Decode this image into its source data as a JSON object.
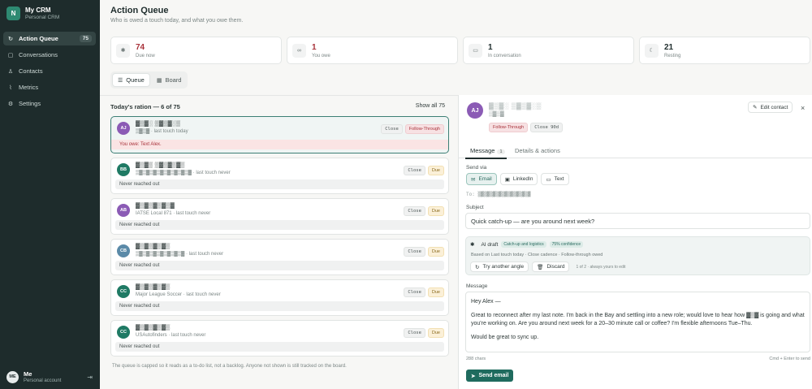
{
  "sidebar": {
    "brand_initial": "N",
    "brand_name": "My CRM",
    "brand_sub": "Personal CRM",
    "items": [
      {
        "label": "Action Queue",
        "icon": "refresh-icon",
        "count": "75"
      },
      {
        "label": "Conversations",
        "icon": "chat-icon"
      },
      {
        "label": "Contacts",
        "icon": "people-icon"
      },
      {
        "label": "Metrics",
        "icon": "chart-icon"
      },
      {
        "label": "Settings",
        "icon": "gear-icon"
      }
    ],
    "user": {
      "initials": "ME",
      "name": "Me",
      "sub": "Personal account"
    }
  },
  "header": {
    "title": "Action Queue",
    "subtitle": "Who is owed a touch today, and what you owe them."
  },
  "stats": [
    {
      "value": "74",
      "label": "Due now",
      "icon": "sparkle-icon"
    },
    {
      "value": "1",
      "label": "You owe",
      "icon": "link-icon"
    },
    {
      "value": "1",
      "label": "In conversation",
      "icon": "chat-icon"
    },
    {
      "value": "21",
      "label": "Resting",
      "icon": "moon-icon"
    }
  ],
  "view_toggle": {
    "queue": "Queue",
    "board": "Board"
  },
  "queue": {
    "title": "Today's ration — 6 of 75",
    "show_all": "Show all 75",
    "cards": [
      {
        "initials": "AJ",
        "name": "▓▒▓░ ▒▓▒▓░▒",
        "sub": "▒▓▒▓ · last touch today",
        "tags": [
          "Close",
          "Follow-Through"
        ],
        "foot": "You owe: Text Alex.",
        "color": "#8b5bb5"
      },
      {
        "initials": "BB",
        "name": "▓▒▓▒ ▒▓▒▓▒▓▒",
        "sub": "▒▓▒▓▒▓▒▓▒▓▒▓▒▓▒▓ · last touch never",
        "tags": [
          "Close",
          "Due"
        ],
        "foot": "Never reached out",
        "color": "#1f7a64"
      },
      {
        "initials": "AB",
        "name": "▓▒▓▒▓▒▓▒▓",
        "sub": "IATSE Local 871 · last touch never",
        "tags": [
          "Close",
          "Due"
        ],
        "foot": "Never reached out",
        "color": "#8b5bb5"
      },
      {
        "initials": "CB",
        "name": "▓▒▓▒▓▒▓▒",
        "sub": "▒▓▒▓▒▓▒▓▒▓▒▓▒▓ · last touch never",
        "tags": [
          "Close",
          "Due"
        ],
        "foot": "Never reached out",
        "color": "#5b8aa8"
      },
      {
        "initials": "CC",
        "name": "▓▒▓▒▓▒▓▒",
        "sub": "Major League Soccer · last touch never",
        "tags": [
          "Close",
          "Due"
        ],
        "foot": "Never reached out",
        "color": "#1f7a64"
      },
      {
        "initials": "CC",
        "name": "▓▒▓▒▓▒▓▒",
        "sub": "USAutofinders · last touch never",
        "tags": [
          "Close",
          "Due"
        ],
        "foot": "Never reached out",
        "color": "#1f7a64"
      }
    ],
    "note": "The queue is capped so it reads as a to-do list, not a backlog. Anyone not shown is still tracked on the board."
  },
  "detail": {
    "initials": "AJ",
    "name": "▓▒▓░ ▒▓▒▓░▒",
    "sub": "▒▓▒▓",
    "tags": [
      "Follow-Through",
      "Close 90d"
    ],
    "edit_label": "Edit contact",
    "close_glyph": "×",
    "tabs": [
      {
        "label": "Message",
        "count": "1"
      },
      {
        "label": "Details & actions"
      }
    ],
    "send_via_label": "Send via",
    "channels": [
      "Email",
      "LinkedIn",
      "Text"
    ],
    "to": "To: ▒▓▒▓▒▓▒▓▒▓▒▓▒▓▒▓▒▓",
    "subject_label": "Subject",
    "subject_value": "Quick catch-up — are you around next week?",
    "ai": {
      "title": "AI draft",
      "chip1": "Catch-up and logistics",
      "chip2": "75% confidence",
      "basis": "Based on Last touch today · Close cadence · Follow-through owed",
      "retry": "Try another angle",
      "discard": "Discard",
      "note": "1 of 2 · always yours to edit"
    },
    "message_label": "Message",
    "message_lines": [
      "Hey Alex —",
      "Great to reconnect after my last note. I'm back in the Bay and settling into a new role; would love to hear how ▓▒▓ is going and what you're working on. Are you around next week for a 20–30 minute call or coffee? I'm flexible afternoons Tue–Thu.",
      "Would be great to sync up."
    ],
    "chars": "288 chars",
    "hint": "Cmd + Enter to send",
    "send_label": "Send email"
  },
  "colors": {
    "accent": "#1f6b5e",
    "sidebar": "#1e2c2c",
    "owe_red": "#a8323a"
  }
}
